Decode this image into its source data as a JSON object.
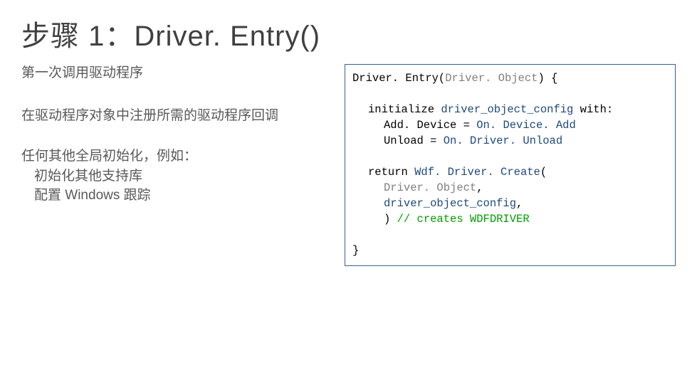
{
  "title": "步骤 1：Driver. Entry()",
  "left": {
    "subhead": "第一次调用驱动程序",
    "p1": "在驱动程序对象中注册所需的驱动程序回调",
    "p2_l1": "任何其他全局初始化，例如：",
    "p2_l2": "初始化其他支持库",
    "p2_l3": "配置 Windows 跟踪"
  },
  "code": {
    "l1a": "Driver. Entry(",
    "l1b": "Driver. Object",
    "l1c": ") {",
    "l3a": "initialize ",
    "l3b": "driver_object_config",
    "l3c": " with:",
    "l4a": "Add. Device = ",
    "l4b": "On. Device. Add",
    "l5a": "Unload = ",
    "l5b": "On. Driver. Unload",
    "l7a": "return ",
    "l7b": "Wdf. Driver. Create",
    "l7c": "(",
    "l8": "Driver. Object",
    "l8c": ",",
    "l9": "driver_object_config",
    "l9c": ",",
    "l10a": ") ",
    "l10b": "// creates WDFDRIVER",
    "l12": "}"
  }
}
